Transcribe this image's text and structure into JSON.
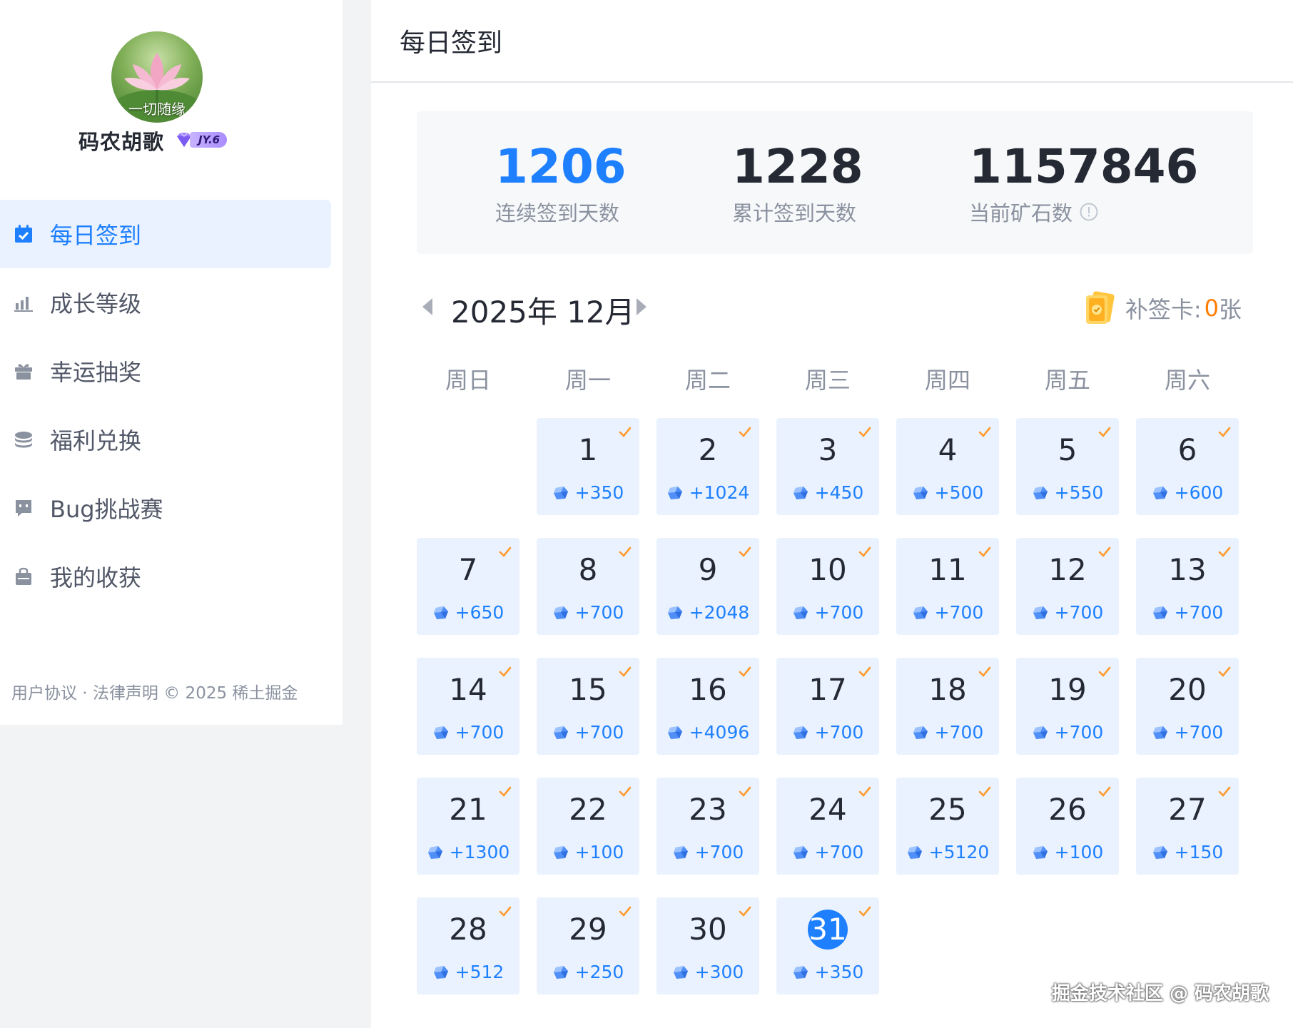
{
  "profile": {
    "avatar_caption": "一切随缘",
    "username": "码农胡歌",
    "level": "JY.6"
  },
  "nav": {
    "items": [
      {
        "label": "每日签到",
        "icon": "calendar-check-icon",
        "active": true
      },
      {
        "label": "成长等级",
        "icon": "bar-chart-icon",
        "active": false
      },
      {
        "label": "幸运抽奖",
        "icon": "gift-icon",
        "active": false
      },
      {
        "label": "福利兑换",
        "icon": "coins-icon",
        "active": false
      },
      {
        "label": "Bug挑战赛",
        "icon": "bug-board-icon",
        "active": false
      },
      {
        "label": "我的收获",
        "icon": "bag-icon",
        "active": false
      }
    ]
  },
  "footer": {
    "text": "用户协议 · 法律声明 © 2025 稀土掘金"
  },
  "header": {
    "title": "每日签到"
  },
  "stats": {
    "streak_value": "1206",
    "streak_label": "连续签到天数",
    "total_value": "1228",
    "total_label": "累计签到天数",
    "ore_value": "1157846",
    "ore_label": "当前矿石数"
  },
  "calendar": {
    "month_title": "2025年 12月",
    "makeup_label": "补签卡:",
    "makeup_count": "0",
    "makeup_unit": "张",
    "weekdays": [
      "周日",
      "周一",
      "周二",
      "周三",
      "周四",
      "周五",
      "周六"
    ],
    "first_weekday": 1,
    "today": 31,
    "days": [
      {
        "day": "1",
        "reward": "+350"
      },
      {
        "day": "2",
        "reward": "+1024"
      },
      {
        "day": "3",
        "reward": "+450"
      },
      {
        "day": "4",
        "reward": "+500"
      },
      {
        "day": "5",
        "reward": "+550"
      },
      {
        "day": "6",
        "reward": "+600"
      },
      {
        "day": "7",
        "reward": "+650"
      },
      {
        "day": "8",
        "reward": "+700"
      },
      {
        "day": "9",
        "reward": "+2048"
      },
      {
        "day": "10",
        "reward": "+700"
      },
      {
        "day": "11",
        "reward": "+700"
      },
      {
        "day": "12",
        "reward": "+700"
      },
      {
        "day": "13",
        "reward": "+700"
      },
      {
        "day": "14",
        "reward": "+700"
      },
      {
        "day": "15",
        "reward": "+700"
      },
      {
        "day": "16",
        "reward": "+4096"
      },
      {
        "day": "17",
        "reward": "+700"
      },
      {
        "day": "18",
        "reward": "+700"
      },
      {
        "day": "19",
        "reward": "+700"
      },
      {
        "day": "20",
        "reward": "+700"
      },
      {
        "day": "21",
        "reward": "+1300"
      },
      {
        "day": "22",
        "reward": "+100"
      },
      {
        "day": "23",
        "reward": "+700"
      },
      {
        "day": "24",
        "reward": "+700"
      },
      {
        "day": "25",
        "reward": "+5120"
      },
      {
        "day": "26",
        "reward": "+100"
      },
      {
        "day": "27",
        "reward": "+150"
      },
      {
        "day": "28",
        "reward": "+512"
      },
      {
        "day": "29",
        "reward": "+250"
      },
      {
        "day": "30",
        "reward": "+300"
      },
      {
        "day": "31",
        "reward": "+350"
      }
    ]
  },
  "colors": {
    "accent": "#1e80ff",
    "check": "#ff9a2e",
    "cell_bg": "#eaf2ff"
  },
  "watermark": "掘金技术社区 @ 码农胡歌"
}
